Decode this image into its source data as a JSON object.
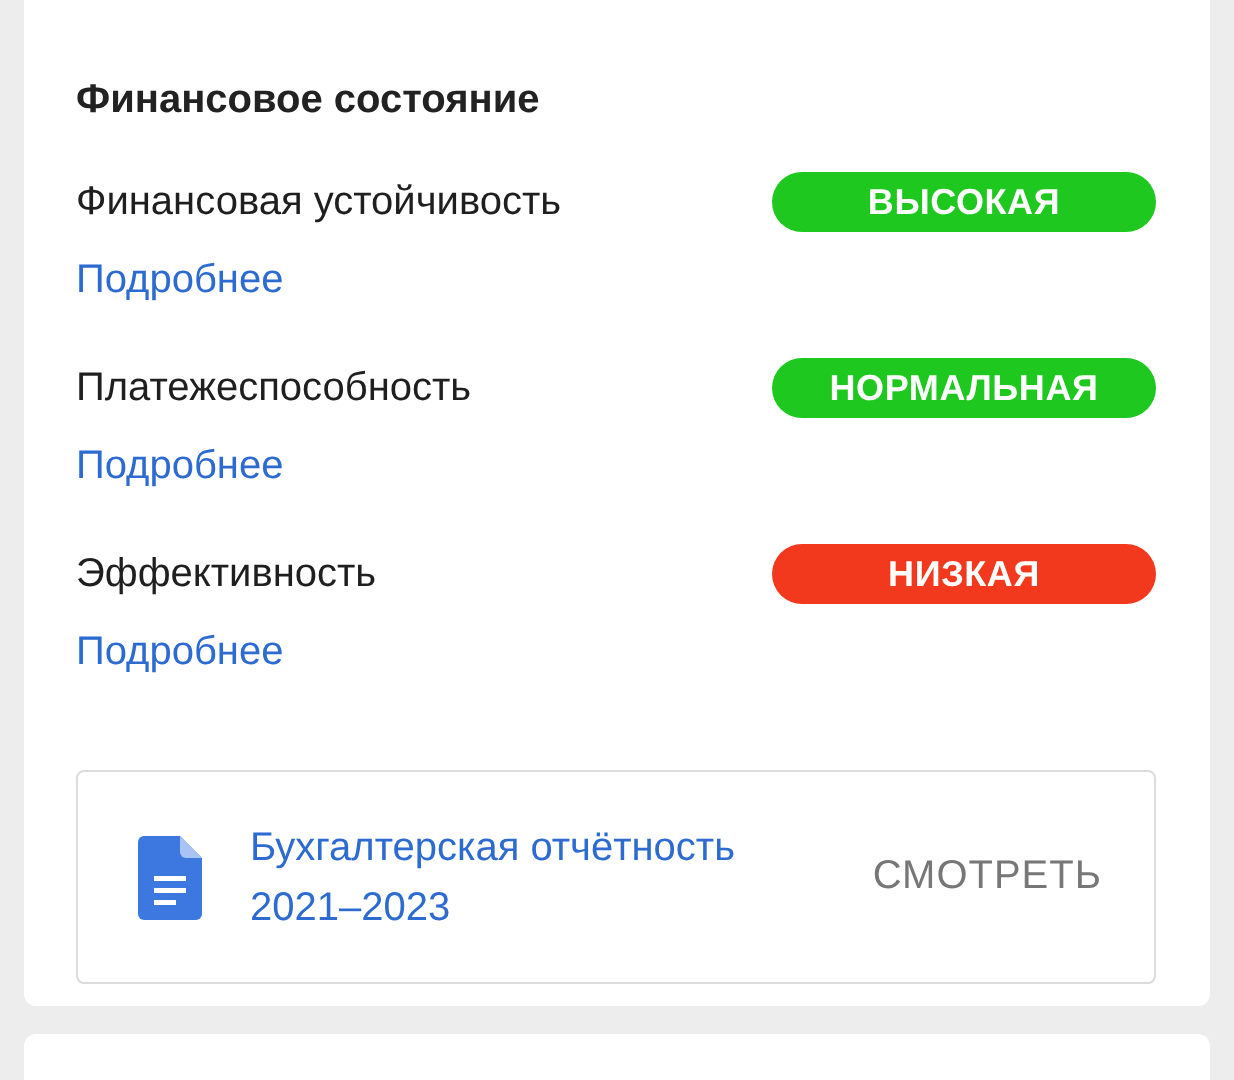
{
  "section": {
    "title": "Финансовое состояние"
  },
  "indicators": [
    {
      "label": "Финансовая устойчивость",
      "status": "ВЫСОКАЯ",
      "color": "#1ec81e",
      "link": "Подробнее"
    },
    {
      "label": "Платежеспособность",
      "status": "НОРМАЛЬНАЯ",
      "color": "#1ec81e",
      "link": "Подробнее"
    },
    {
      "label": "Эффективность",
      "status": "НИЗКАЯ",
      "color": "#f2391d",
      "link": "Подробнее"
    }
  ],
  "document": {
    "title": "Бухгалтерская отчётность 2021–2023",
    "action": "СМОТРЕТЬ"
  }
}
